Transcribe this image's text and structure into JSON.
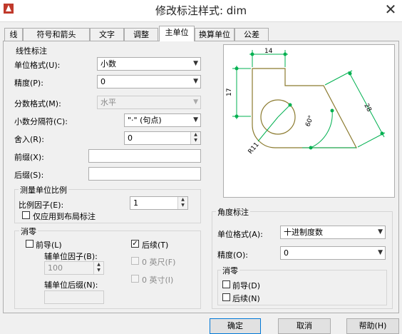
{
  "window": {
    "title": "修改标注样式: dim",
    "close_glyph": "✕"
  },
  "tabs": [
    {
      "label": "线"
    },
    {
      "label": "符号和箭头"
    },
    {
      "label": "文字"
    },
    {
      "label": "调整"
    },
    {
      "label": "主单位"
    },
    {
      "label": "换算单位"
    },
    {
      "label": "公差"
    }
  ],
  "linear": {
    "title": "线性标注",
    "unit_format_label": "单位格式(U):",
    "unit_format_value": "小数",
    "precision_label": "精度(P):",
    "precision_value": "0",
    "fraction_label": "分数格式(M):",
    "fraction_value": "水平",
    "decimal_sep_label": "小数分隔符(C):",
    "decimal_sep_value": "\"·\" (句点)",
    "round_label": "舍入(R):",
    "round_value": "0",
    "prefix_label": "前缀(X):",
    "prefix_value": "",
    "suffix_label": "后缀(S):",
    "suffix_value": ""
  },
  "scale": {
    "title": "测量单位比例",
    "factor_label": "比例因子(E):",
    "factor_value": "1",
    "layout_only_label": "仅应用到布局标注",
    "layout_only_checked": false
  },
  "zero_suppression": {
    "title": "消零",
    "leading_label": "前导(L)",
    "leading_checked": false,
    "trailing_label": "后续(T)",
    "trailing_checked": true,
    "sub_factor_label": "辅单位因子(B):",
    "sub_factor_value": "100",
    "sub_suffix_label": "辅单位后缀(N):",
    "sub_suffix_value": "",
    "feet_label": "0 英尺(F)",
    "inches_label": "0 英寸(I)"
  },
  "preview": {
    "dim_top": "14",
    "dim_left": "17",
    "dim_diag": "28",
    "dim_angle": "60°",
    "dim_radius": "R11",
    "line_color": "#00b050",
    "shape_color": "#8b7a2e"
  },
  "angular": {
    "title": "角度标注",
    "unit_format_label": "单位格式(A):",
    "unit_format_value": "十进制度数",
    "precision_label": "精度(O):",
    "precision_value": "0",
    "zero_title": "消零",
    "leading_label": "前导(D)",
    "leading_checked": false,
    "trailing_label": "后续(N)",
    "trailing_checked": false
  },
  "buttons": {
    "ok": "确定",
    "cancel": "取消",
    "help": "帮助(H)"
  }
}
